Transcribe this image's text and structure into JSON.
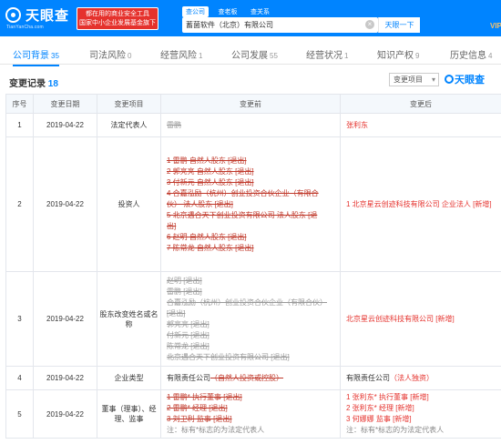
{
  "header": {
    "logo_name": "天眼查",
    "logo_url": "TianYanCha.com",
    "slogan_line1": "都在用的商业安全工具",
    "slogan_line2": "国家中小企业发展基金旗下",
    "search_tabs": [
      "查公司",
      "查老板",
      "查关系"
    ],
    "search_value": "蓄菌软件（北京）有限公司",
    "search_button": "天眼一下",
    "vip": "VIP"
  },
  "nav_tabs": [
    {
      "label": "公司背景",
      "count": "35"
    },
    {
      "label": "司法风险",
      "count": "0"
    },
    {
      "label": "经营风险",
      "count": "1"
    },
    {
      "label": "公司发展",
      "count": "55"
    },
    {
      "label": "经营状况",
      "count": "1"
    },
    {
      "label": "知识产权",
      "count": "9"
    },
    {
      "label": "历史信息",
      "count": "4"
    }
  ],
  "section": {
    "title": "变更记录",
    "count": "18",
    "filter_label": "变更项目",
    "brand": "天眼查"
  },
  "table": {
    "headers": [
      "序号",
      "变更日期",
      "变更项目",
      "变更前",
      "变更后"
    ],
    "rows": [
      {
        "no": "1",
        "date": "2019-04-22",
        "item": "法定代表人",
        "before": [
          {
            "text": "雷鹏",
            "style": "grayst"
          }
        ],
        "after": [
          {
            "text": "张利东",
            "style": "red"
          }
        ]
      },
      {
        "no": "2",
        "date": "2019-04-22",
        "item": "投资人",
        "before": [
          {
            "text": "1 雷鹏 自然人股东 [退出]",
            "style": "strike"
          },
          {
            "text": "2 郭亮亮 自然人股东 [退出]",
            "style": "strike"
          },
          {
            "text": "3 付新元 自然人股东 [退出]",
            "style": "strike"
          },
          {
            "text": "4 合嘉泓励（杭州）创业投资合伙企业（有限合",
            "style": "strike"
          },
          {
            "text": "伙） 法人股东 [退出]",
            "style": "strike"
          },
          {
            "text": "5 北京遇合天下创业投资有限公司 法人股东 [退",
            "style": "strike"
          },
          {
            "text": "出]",
            "style": "strike"
          },
          {
            "text": "6 赵明 自然人股东 [退出]",
            "style": "strike"
          },
          {
            "text": "7 陈常龙 自然人股东 [退出]",
            "style": "strike"
          }
        ],
        "after": [
          {
            "text": "1 北京星云创迹科技有限公司 企业法人 [新增]",
            "style": "red"
          }
        ]
      },
      {
        "no": "3",
        "date": "2019-04-22",
        "item": "股东改变姓名或名称",
        "before": [
          {
            "text": "赵明 [退出]",
            "style": "grayst"
          },
          {
            "text": "雷鹏 [退出]",
            "style": "grayst"
          },
          {
            "text": "合嘉泓励（杭州）创业投资合伙企业（有限合伙）",
            "style": "grayst"
          },
          {
            "text": "[退出]",
            "style": "grayst"
          },
          {
            "text": "郭亮亮 [退出]",
            "style": "grayst"
          },
          {
            "text": "付新元 [退出]",
            "style": "grayst"
          },
          {
            "text": "陈常龙 [退出]",
            "style": "grayst"
          },
          {
            "text": "北京遇合天下创业投资有限公司 [退出]",
            "style": "grayst"
          }
        ],
        "after": [
          {
            "text": "北京星云创迹科技有限公司 [新增]",
            "style": "red"
          }
        ]
      },
      {
        "no": "4",
        "date": "2019-04-22",
        "item": "企业类型",
        "before": [
          {
            "text": "有限责任公司（自然人投资或控股）",
            "style": "mixed4b"
          }
        ],
        "after": [
          {
            "text": "有限责任公司（法人独资）",
            "style": "mixed4a"
          }
        ]
      },
      {
        "no": "5",
        "date": "2019-04-22",
        "item": "董事（理事）、经理、监事",
        "before": [
          {
            "text": "1 雷鹏* 执行董事 [退出]",
            "style": "strike"
          },
          {
            "text": "2 雷鹏* 经理 [退出]",
            "style": "strike"
          },
          {
            "text": "3 刘卫利 监事 [退出]",
            "style": "strike"
          },
          {
            "text": "注：标有*标志的为法定代表人",
            "style": "note"
          }
        ],
        "after": [
          {
            "text": "1 张利东* 执行董事 [新增]",
            "style": "red"
          },
          {
            "text": "2 张利东* 经理 [新增]",
            "style": "red"
          },
          {
            "text": "3 何娜娜 监事 [新增]",
            "style": "red"
          },
          {
            "text": "注：标有*标志的为法定代表人",
            "style": "note"
          }
        ]
      }
    ]
  },
  "colors": {
    "brand": "#0084ff",
    "removed": "#c0392b",
    "added": "#e5322d",
    "header_bg": "#f4f8fc"
  }
}
